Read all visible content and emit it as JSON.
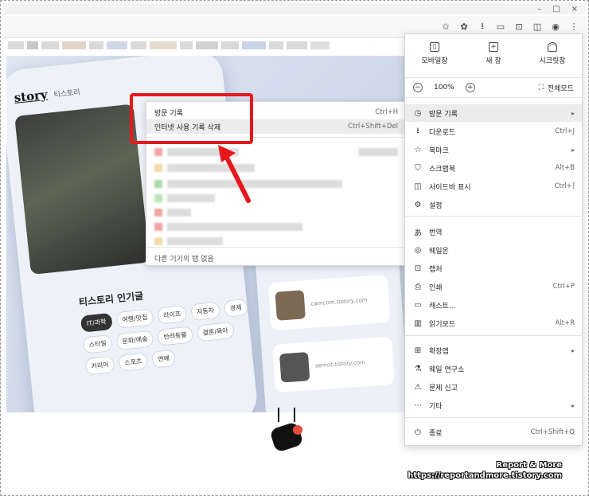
{
  "window": {
    "controls": [
      "–",
      "□",
      "×"
    ]
  },
  "toolbar": {
    "icons": [
      "star-add-icon",
      "extension-icon",
      "download-icon",
      "video-icon",
      "screenshot-icon",
      "sidebar-icon",
      "profile-icon",
      "more-icon"
    ]
  },
  "history_submenu": {
    "history": {
      "label": "방문 기록",
      "shortcut": "Ctrl+H"
    },
    "clear": {
      "label": "인터넷 사용 기록 삭제",
      "shortcut": "Ctrl+Shift+Del"
    },
    "footer": "다른 기기의 탭 없음"
  },
  "background_page": {
    "logo": "story",
    "subtitle": "티스토리",
    "popular_title": "티스토리 인기글",
    "chips": [
      "IT/과학",
      "여행/맛집",
      "라이프",
      "자동차",
      "경제",
      "스타일",
      "문화/예술",
      "반려동물",
      "결혼/육아",
      "커리어",
      "스포츠",
      "연예"
    ],
    "card_domains": [
      "camcom.tistory.com",
      "semot.tistory.com"
    ]
  },
  "menu": {
    "quick": [
      {
        "label": "모바일창",
        "icon": "mobile-icon"
      },
      {
        "label": "새 창",
        "icon": "new-window-icon"
      },
      {
        "label": "시크릿창",
        "icon": "secret-icon"
      }
    ],
    "zoom": {
      "value": "100%",
      "fullscreen": "전체모드"
    },
    "items": [
      {
        "label": "방문 기록",
        "shortcut": "",
        "submenu": true,
        "icon": "history-icon"
      },
      {
        "label": "다운로드",
        "shortcut": "Ctrl+J",
        "submenu": false,
        "icon": "download-icon"
      },
      {
        "label": "북마크",
        "shortcut": "",
        "submenu": true,
        "icon": "bookmark-icon"
      },
      {
        "label": "스크랩북",
        "shortcut": "Alt+B",
        "submenu": false,
        "icon": "scrapbook-icon"
      },
      {
        "label": "사이드바 표시",
        "shortcut": "Ctrl+]",
        "submenu": false,
        "icon": "sidebar-icon"
      },
      {
        "label": "설정",
        "shortcut": "",
        "submenu": false,
        "icon": "settings-icon"
      },
      {
        "label": "번역",
        "shortcut": "",
        "submenu": false,
        "icon": "translate-icon"
      },
      {
        "label": "웨일온",
        "shortcut": "",
        "submenu": false,
        "icon": "whale-on-icon"
      },
      {
        "label": "캡처",
        "shortcut": "",
        "submenu": false,
        "icon": "capture-icon"
      },
      {
        "label": "인쇄",
        "shortcut": "Ctrl+P",
        "submenu": false,
        "icon": "print-icon"
      },
      {
        "label": "캐스트...",
        "shortcut": "",
        "submenu": false,
        "icon": "cast-icon"
      },
      {
        "label": "읽기모드",
        "shortcut": "Alt+R",
        "submenu": false,
        "icon": "reading-mode-icon"
      },
      {
        "label": "확장앱",
        "shortcut": "",
        "submenu": true,
        "icon": "extensions-icon"
      },
      {
        "label": "웨일 연구소",
        "shortcut": "",
        "submenu": false,
        "icon": "labs-icon"
      },
      {
        "label": "문제 신고",
        "shortcut": "",
        "submenu": false,
        "icon": "report-icon"
      },
      {
        "label": "기타",
        "shortcut": "",
        "submenu": true,
        "icon": "etc-icon"
      },
      {
        "label": "종료",
        "shortcut": "Ctrl+Shift+Q",
        "submenu": false,
        "icon": "exit-icon"
      }
    ]
  },
  "watermark": {
    "line1": "Report & More",
    "line2": "https://reportandmore.tistory.com"
  },
  "colors": {
    "highlight": "#e8171c",
    "menu_hover": "#ececec"
  }
}
